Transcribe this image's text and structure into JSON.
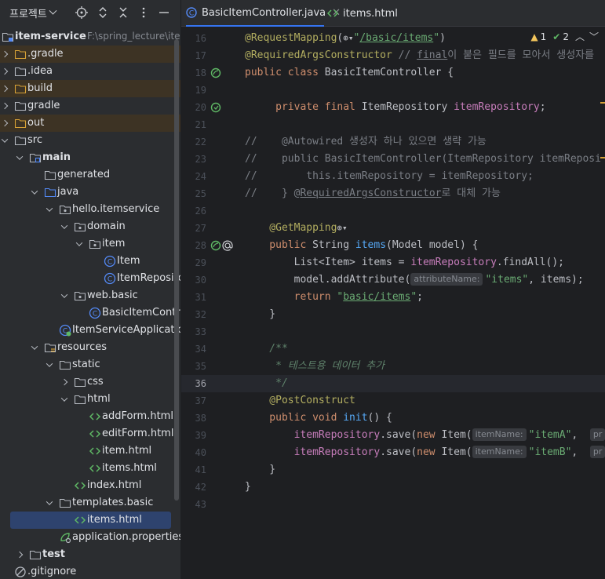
{
  "panel": {
    "title": "프로젝트",
    "icons": [
      "crosshair-icon",
      "expand-collapse-icon",
      "collapse-all-icon",
      "more-options-icon",
      "minimize-icon"
    ]
  },
  "tree": [
    {
      "label": "item-service",
      "path": "F:\\spring_lecture\\item",
      "bold": true,
      "icon": "module-icon",
      "indent": 0,
      "chevron": "none"
    },
    {
      "label": ".gradle",
      "icon": "folder-excluded-icon",
      "indent": 1,
      "chevron": "closed",
      "highlight": true
    },
    {
      "label": ".idea",
      "icon": "folder-icon",
      "indent": 1,
      "chevron": "closed"
    },
    {
      "label": "build",
      "icon": "folder-excluded-icon",
      "indent": 1,
      "chevron": "closed",
      "highlight": true
    },
    {
      "label": "gradle",
      "icon": "folder-icon",
      "indent": 1,
      "chevron": "closed"
    },
    {
      "label": "out",
      "icon": "folder-excluded-icon",
      "indent": 1,
      "chevron": "closed",
      "highlight": true
    },
    {
      "label": "src",
      "icon": "folder-icon",
      "indent": 1,
      "chevron": "open"
    },
    {
      "label": "main",
      "bold": true,
      "icon": "source-root-folder-icon",
      "indent": 2,
      "chevron": "open"
    },
    {
      "label": "generated",
      "icon": "folder-icon",
      "indent": 3,
      "chevron": "none"
    },
    {
      "label": "java",
      "icon": "source-folder-icon",
      "indent": 3,
      "chevron": "open"
    },
    {
      "label": "hello.itemservice",
      "icon": "package-icon",
      "indent": 4,
      "chevron": "open"
    },
    {
      "label": "domain",
      "icon": "package-icon",
      "indent": 5,
      "chevron": "open"
    },
    {
      "label": "item",
      "icon": "package-icon",
      "indent": 6,
      "chevron": "open"
    },
    {
      "label": "Item",
      "icon": "class-icon",
      "indent": 7,
      "chevron": "none"
    },
    {
      "label": "ItemRepository",
      "icon": "class-icon",
      "indent": 7,
      "chevron": "none"
    },
    {
      "label": "web.basic",
      "icon": "package-icon",
      "indent": 5,
      "chevron": "open"
    },
    {
      "label": "BasicItemController",
      "icon": "class-icon",
      "indent": 6,
      "chevron": "none"
    },
    {
      "label": "ItemServiceApplication",
      "icon": "spring-class-icon",
      "indent": 4,
      "chevron": "none"
    },
    {
      "label": "resources",
      "icon": "resources-folder-icon",
      "indent": 3,
      "chevron": "open"
    },
    {
      "label": "static",
      "icon": "folder-icon",
      "indent": 4,
      "chevron": "open"
    },
    {
      "label": "css",
      "icon": "folder-icon",
      "indent": 5,
      "chevron": "closed"
    },
    {
      "label": "html",
      "icon": "folder-icon",
      "indent": 5,
      "chevron": "open"
    },
    {
      "label": "addForm.html",
      "icon": "html-file-icon",
      "indent": 6,
      "chevron": "none"
    },
    {
      "label": "editForm.html",
      "icon": "html-file-icon",
      "indent": 6,
      "chevron": "none"
    },
    {
      "label": "item.html",
      "icon": "html-file-icon",
      "indent": 6,
      "chevron": "none"
    },
    {
      "label": "items.html",
      "icon": "html-file-icon",
      "indent": 6,
      "chevron": "none"
    },
    {
      "label": "index.html",
      "icon": "html-file-icon",
      "indent": 5,
      "chevron": "none"
    },
    {
      "label": "templates.basic",
      "icon": "folder-icon",
      "indent": 4,
      "chevron": "open"
    },
    {
      "label": "items.html",
      "icon": "html-file-icon",
      "indent": 5,
      "chevron": "none",
      "selected": true
    },
    {
      "label": "application.properties",
      "icon": "properties-file-icon",
      "indent": 4,
      "chevron": "none"
    },
    {
      "label": "test",
      "bold": true,
      "icon": "folder-icon",
      "indent": 2,
      "chevron": "closed"
    },
    {
      "label": ".gitignore",
      "icon": "gitignore-icon",
      "indent": 1,
      "chevron": "none"
    }
  ],
  "tabs": [
    {
      "label": "BasicItemController.java",
      "icon": "class-icon",
      "active": true,
      "closable": true
    },
    {
      "label": "items.html",
      "icon": "html-file-icon",
      "active": false,
      "closable": false
    }
  ],
  "inspections": {
    "warnings": "1",
    "ok": "2"
  },
  "code": {
    "current_line": 36,
    "lines": [
      {
        "n": 16,
        "gutter": "",
        "tokens": [
          [
            "a",
            "@RequestMapping"
          ],
          [
            "",
            "("
          ],
          [
            "globe",
            "⊕▾"
          ],
          [
            "s",
            "\""
          ],
          [
            "su",
            "/basic/items"
          ],
          [
            "s",
            "\""
          ],
          [
            "",
            ")"
          ]
        ]
      },
      {
        "n": 17,
        "gutter": "",
        "tokens": [
          [
            "a",
            "@RequiredArgsConstructor"
          ],
          [
            "",
            " "
          ],
          [
            "c",
            "// "
          ],
          [
            "cu",
            "final"
          ],
          [
            "c",
            "이 붙은 필드를 모아서 생성자를"
          ]
        ]
      },
      {
        "n": 18,
        "gutter": "bean-icon",
        "tokens": [
          [
            "k",
            "public class "
          ],
          [
            "",
            "BasicItemController {"
          ]
        ]
      },
      {
        "n": 19,
        "gutter": "",
        "tokens": []
      },
      {
        "n": 20,
        "gutter": "bean-inject-icon",
        "tokens": [
          [
            "",
            " "
          ],
          [
            "k",
            "    private final "
          ],
          [
            "",
            "ItemRepository "
          ],
          [
            "fld",
            "itemRepository"
          ],
          [
            "",
            ";"
          ]
        ]
      },
      {
        "n": 21,
        "gutter": "",
        "tokens": []
      },
      {
        "n": 22,
        "gutter": "",
        "tokens": [
          [
            "c",
            "//    @Autowired 생성자 하나 있으면 생략 가능"
          ]
        ]
      },
      {
        "n": 23,
        "gutter": "",
        "tokens": [
          [
            "c",
            "//    public BasicItemController(ItemRepository itemReposi"
          ]
        ]
      },
      {
        "n": 24,
        "gutter": "",
        "tokens": [
          [
            "c",
            "//        this.itemRepository = itemRepository;"
          ]
        ]
      },
      {
        "n": 25,
        "gutter": "",
        "tokens": [
          [
            "c",
            "//    } @"
          ],
          [
            "cu",
            "RequiredArgsConstructor"
          ],
          [
            "c",
            "로 대체 가능"
          ]
        ]
      },
      {
        "n": 26,
        "gutter": "",
        "tokens": []
      },
      {
        "n": 27,
        "gutter": "",
        "tokens": [
          [
            "a",
            "    @GetMapping"
          ],
          [
            "globe",
            "⊕▾"
          ]
        ]
      },
      {
        "n": 28,
        "gutter": "request-mapping-icon",
        "tokens": [
          [
            "k",
            "    public "
          ],
          [
            "",
            "String "
          ],
          [
            "f",
            "items"
          ],
          [
            "",
            "(Model model) {"
          ]
        ]
      },
      {
        "n": 29,
        "gutter": "",
        "tokens": [
          [
            "",
            "        List<Item> items = "
          ],
          [
            "fld",
            "itemRepository"
          ],
          [
            "",
            ".findAll();"
          ]
        ]
      },
      {
        "n": 30,
        "gutter": "",
        "tokens": [
          [
            "",
            "        model.addAttribute("
          ],
          [
            "hint",
            "attributeName:"
          ],
          [
            "s",
            "\"items\""
          ],
          [
            "",
            ", items);"
          ]
        ]
      },
      {
        "n": 31,
        "gutter": "",
        "tokens": [
          [
            "k",
            "        return "
          ],
          [
            "s",
            "\""
          ],
          [
            "su",
            "basic/items"
          ],
          [
            "s",
            "\""
          ],
          [
            "",
            ";"
          ]
        ]
      },
      {
        "n": 32,
        "gutter": "",
        "tokens": [
          [
            "",
            "    }"
          ]
        ]
      },
      {
        "n": 33,
        "gutter": "",
        "tokens": []
      },
      {
        "n": 34,
        "gutter": "",
        "tokens": [
          [
            "cd",
            "    /**"
          ]
        ]
      },
      {
        "n": 35,
        "gutter": "",
        "tokens": [
          [
            "cd",
            "     * 테스트용 데이터 추가"
          ]
        ]
      },
      {
        "n": 36,
        "gutter": "",
        "tokens": [
          [
            "cd",
            "     */"
          ]
        ]
      },
      {
        "n": 37,
        "gutter": "",
        "tokens": [
          [
            "a",
            "    @PostConstruct"
          ]
        ]
      },
      {
        "n": 38,
        "gutter": "",
        "tokens": [
          [
            "k",
            "    public void "
          ],
          [
            "f",
            "init"
          ],
          [
            "",
            "() {"
          ]
        ]
      },
      {
        "n": 39,
        "gutter": "",
        "tokens": [
          [
            "fld",
            "        itemRepository"
          ],
          [
            "",
            ".save("
          ],
          [
            "k",
            "new "
          ],
          [
            "",
            "Item("
          ],
          [
            "hint",
            "itemName:"
          ],
          [
            "s",
            "\"itemA\""
          ],
          [
            "",
            ",  "
          ],
          [
            "hint",
            "pr"
          ]
        ]
      },
      {
        "n": 40,
        "gutter": "",
        "tokens": [
          [
            "fld",
            "        itemRepository"
          ],
          [
            "",
            ".save("
          ],
          [
            "k",
            "new "
          ],
          [
            "",
            "Item("
          ],
          [
            "hint",
            "itemName:"
          ],
          [
            "s",
            "\"itemB\""
          ],
          [
            "",
            ",  "
          ],
          [
            "hint",
            "pr"
          ]
        ]
      },
      {
        "n": 41,
        "gutter": "",
        "tokens": [
          [
            "",
            "    }"
          ]
        ]
      },
      {
        "n": 42,
        "gutter": "",
        "tokens": [
          [
            "",
            "}"
          ]
        ]
      },
      {
        "n": 43,
        "gutter": "",
        "tokens": []
      }
    ]
  },
  "colors": {
    "accent": "#3574f0",
    "selection": "#2e436e",
    "excluded_highlight": "#3d3324"
  }
}
